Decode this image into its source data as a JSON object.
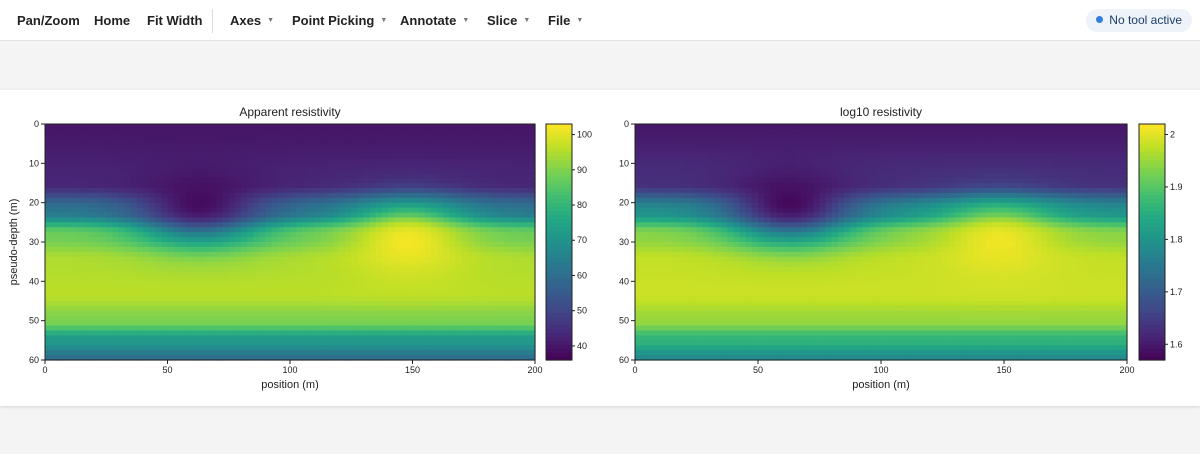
{
  "toolbar": {
    "pan_zoom": "Pan/Zoom",
    "home": "Home",
    "fit_width": "Fit Width",
    "axes": "Axes",
    "point_picking": "Point Picking",
    "annotate": "Annotate",
    "slice": "Slice",
    "file": "File",
    "status": "No tool active"
  },
  "colors": {
    "viridis": [
      "#440154",
      "#482475",
      "#414487",
      "#355f8d",
      "#2a788e",
      "#21918c",
      "#22a884",
      "#44bf70",
      "#7ad151",
      "#bddf26",
      "#fde725"
    ]
  },
  "chart_data": [
    {
      "type": "heatmap",
      "title": "Apparent resistivity",
      "xlabel": "position (m)",
      "ylabel": "pseudo-depth (m)",
      "xlim": [
        0,
        200
      ],
      "ylim": [
        60,
        0
      ],
      "x_ticks": [
        0,
        50,
        100,
        150,
        200
      ],
      "y_ticks": [
        0,
        10,
        20,
        30,
        40,
        50,
        60
      ],
      "colorbar": {
        "range": [
          36,
          103
        ],
        "ticks": [
          40,
          50,
          60,
          70,
          80,
          90,
          100
        ]
      },
      "field": {
        "background_layers": [
          {
            "depth": 0,
            "value": 40
          },
          {
            "depth": 15,
            "value": 43
          },
          {
            "depth": 22,
            "value": 62
          },
          {
            "depth": 28,
            "value": 88
          },
          {
            "depth": 35,
            "value": 95
          },
          {
            "depth": 43,
            "value": 96
          },
          {
            "depth": 50,
            "value": 90
          },
          {
            "depth": 55,
            "value": 72
          },
          {
            "depth": 60,
            "value": 60
          }
        ],
        "low_anomaly": {
          "x": 63,
          "depth": 20,
          "value": 38
        },
        "high_anomaly": {
          "x": 148,
          "depth": 30,
          "value": 102
        }
      }
    },
    {
      "type": "heatmap",
      "title": "log10 resistivity",
      "xlabel": "position (m)",
      "ylabel": "",
      "xlim": [
        0,
        200
      ],
      "ylim": [
        60,
        0
      ],
      "x_ticks": [
        0,
        50,
        100,
        150,
        200
      ],
      "y_ticks": [
        0,
        10,
        20,
        30,
        40,
        50,
        60
      ],
      "colorbar": {
        "range": [
          1.57,
          2.02
        ],
        "ticks": [
          1.6,
          1.7,
          1.8,
          1.9,
          2
        ]
      },
      "field": {
        "background_layers": [
          {
            "depth": 0,
            "value": 1.6
          },
          {
            "depth": 15,
            "value": 1.63
          },
          {
            "depth": 22,
            "value": 1.79
          },
          {
            "depth": 28,
            "value": 1.94
          },
          {
            "depth": 35,
            "value": 1.98
          },
          {
            "depth": 43,
            "value": 1.985
          },
          {
            "depth": 50,
            "value": 1.95
          },
          {
            "depth": 55,
            "value": 1.86
          },
          {
            "depth": 60,
            "value": 1.78
          }
        ],
        "low_anomaly": {
          "x": 63,
          "depth": 20,
          "value": 1.58
        },
        "high_anomaly": {
          "x": 148,
          "depth": 30,
          "value": 2.01
        }
      }
    }
  ]
}
